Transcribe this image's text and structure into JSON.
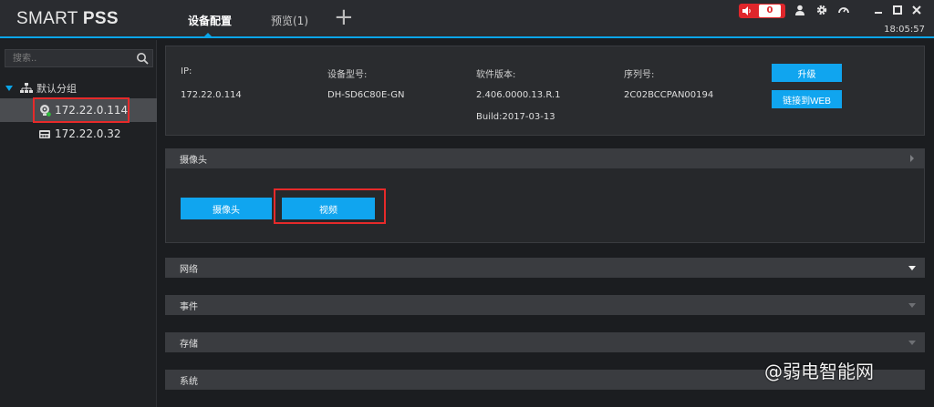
{
  "app": {
    "logo_light": "SMART ",
    "logo_bold": "PSS"
  },
  "tabs": [
    {
      "label": "设备配置",
      "active": true
    },
    {
      "label": "预览(1)",
      "active": false
    }
  ],
  "titlebar": {
    "alarm_count": "0",
    "time": "18:05:57",
    "icons": [
      "speaker-icon",
      "user-icon",
      "gear-icon",
      "gauge-icon",
      "minimize-icon",
      "maximize-icon",
      "close-icon"
    ]
  },
  "sidebar": {
    "search_placeholder": "搜索..",
    "group_label": "默认分组",
    "devices": [
      {
        "label": "172.22.0.114",
        "selected": true,
        "icon": "camera-online-icon"
      },
      {
        "label": "172.22.0.32",
        "selected": false,
        "icon": "nvr-device-icon"
      }
    ]
  },
  "info": {
    "ip_label": "IP:",
    "ip_value": "172.22.0.114",
    "model_label": "设备型号:",
    "model_value": "DH-SD6C80E-GN",
    "software_label": "软件版本:",
    "software_value": "2.406.0000.13.R.1",
    "build_value": "Build:2017-03-13",
    "serial_label": "序列号:",
    "serial_value": "2C02BCCPAN00194",
    "upgrade_label": "升级",
    "web_label": "链接到WEB"
  },
  "sections": {
    "camera": {
      "title": "摄像头",
      "btn_camera": "摄像头",
      "btn_video": "视频"
    },
    "network": "网络",
    "event": "事件",
    "storage": "存储",
    "system": "系统"
  },
  "watermark": "@弱电智能网",
  "colors": {
    "accent": "#0aa6ea",
    "button": "#10a5ef",
    "alarm": "#e0262b",
    "highlight": "#e62a2a"
  }
}
